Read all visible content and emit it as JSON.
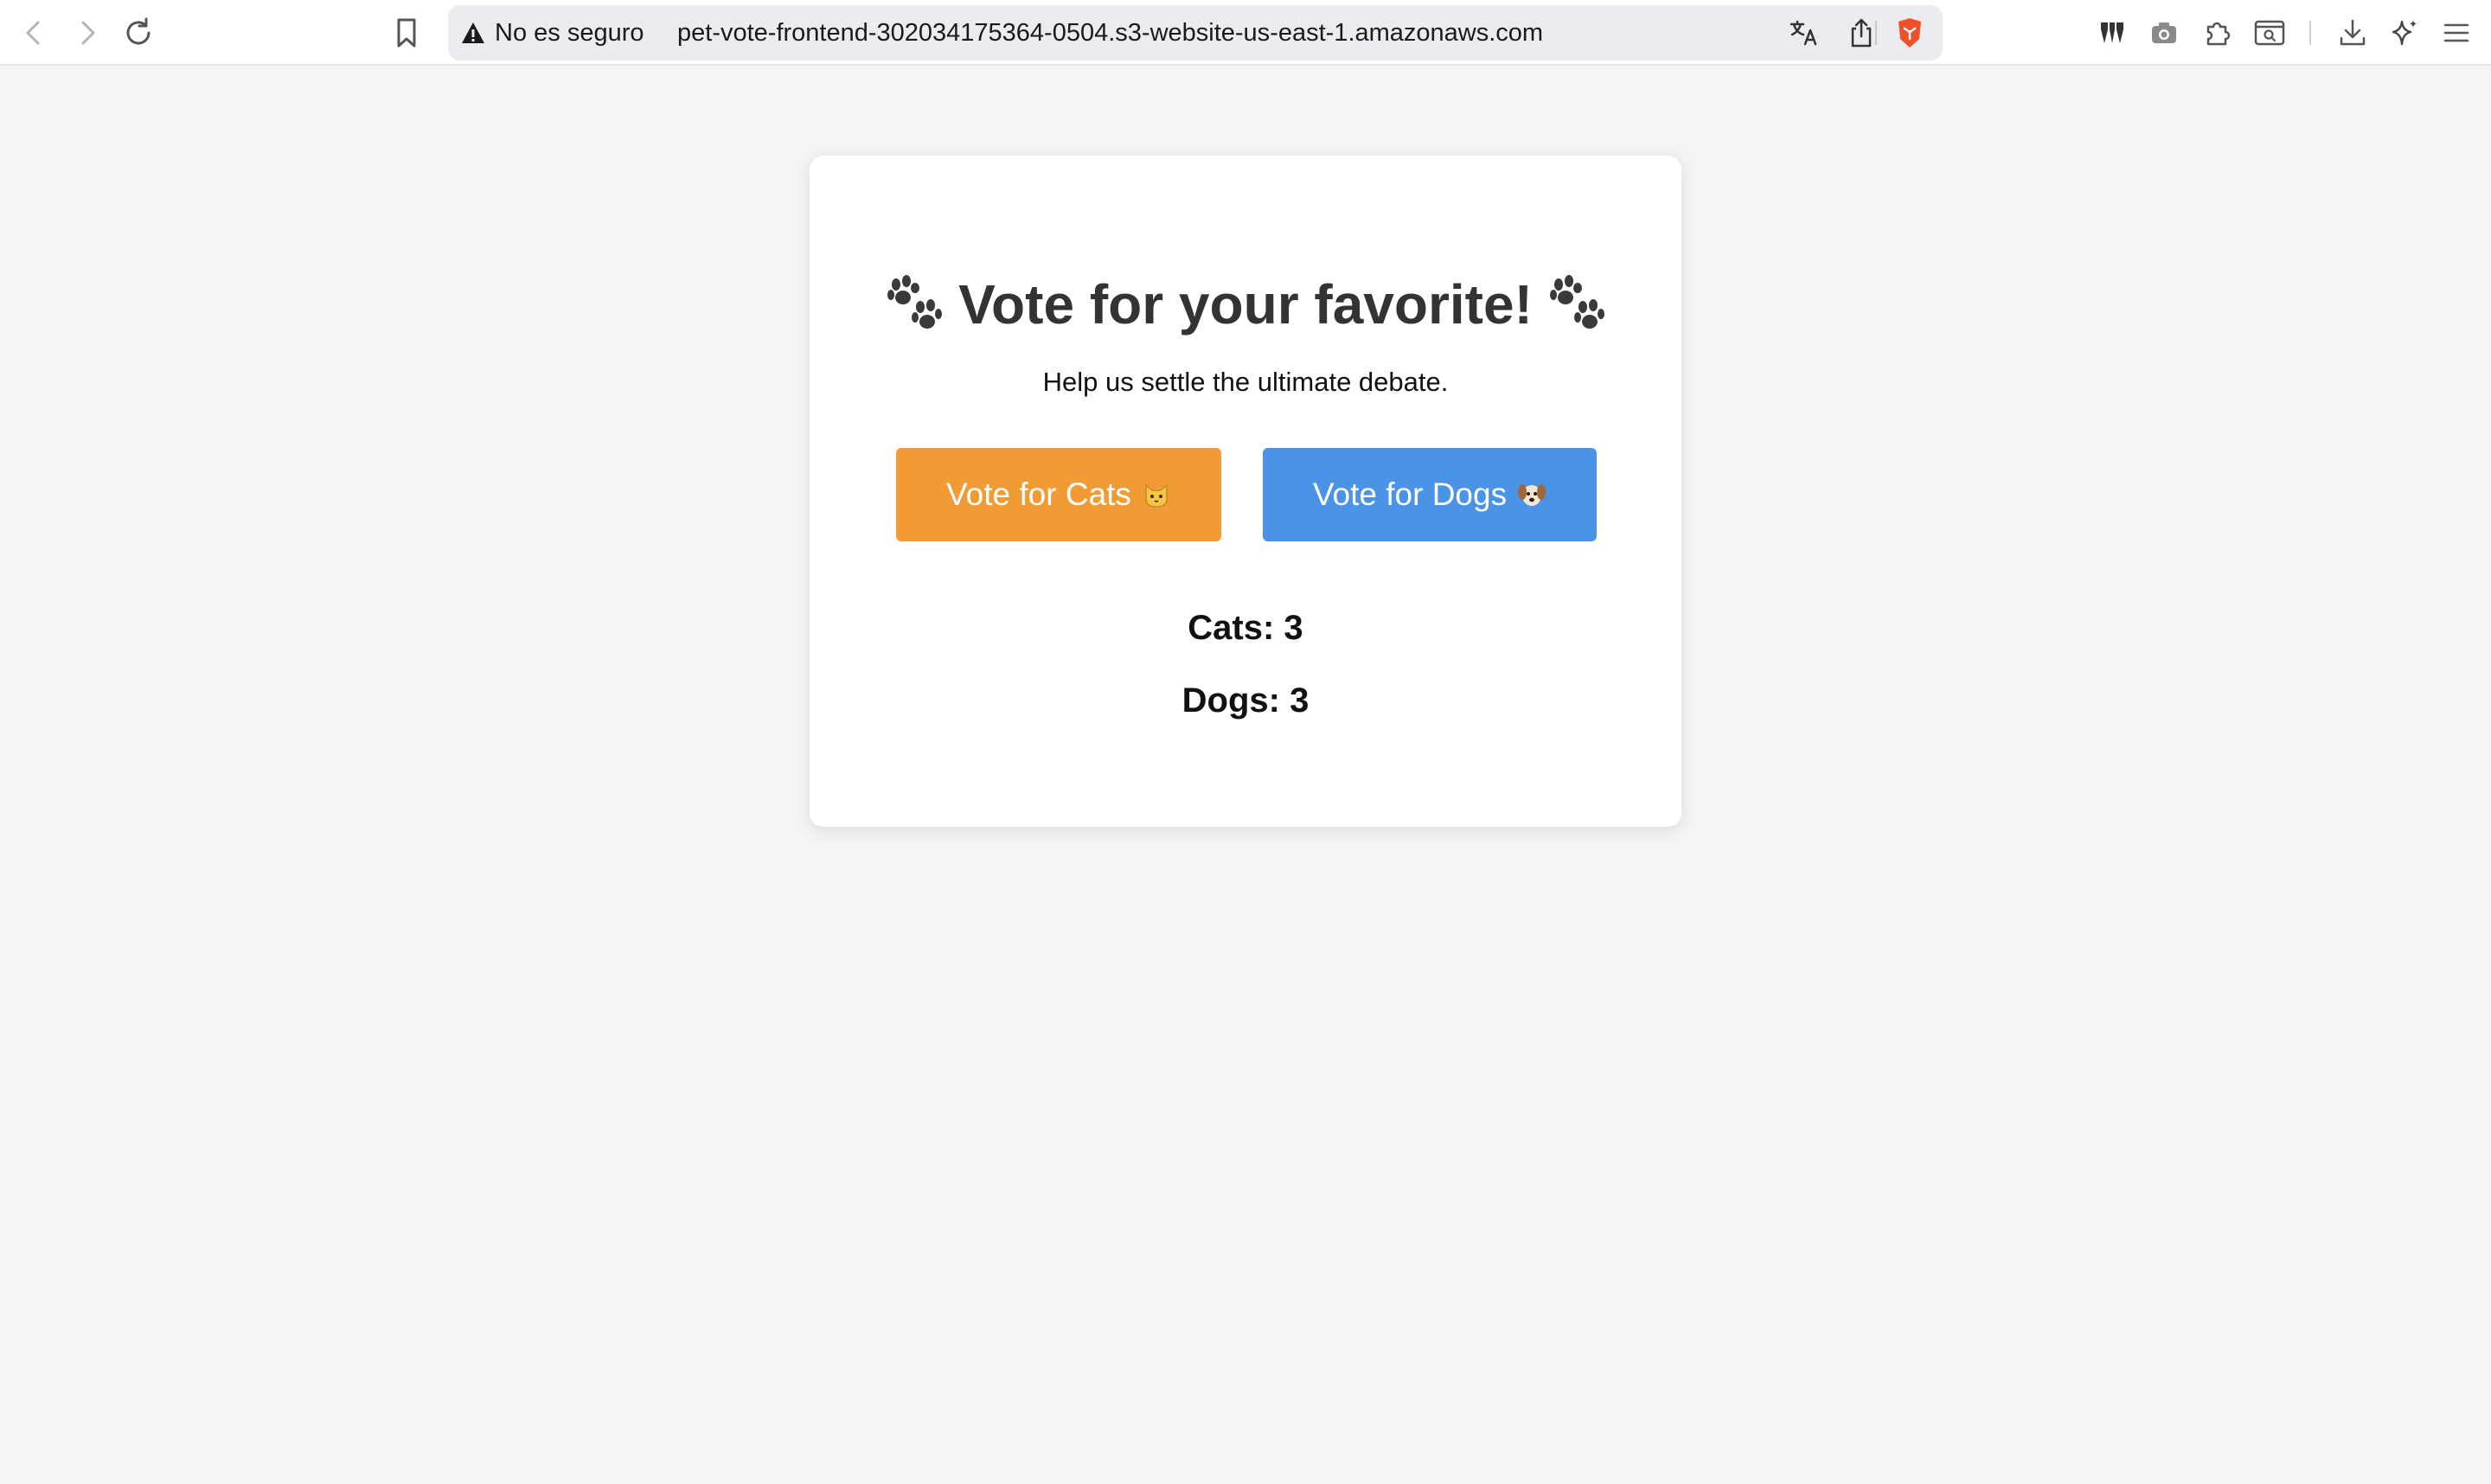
{
  "browser": {
    "security_label": "No es seguro",
    "url": "pet-vote-frontend-302034175364-0504.s3-website-us-east-1.amazonaws.com",
    "icons": [
      "back-icon",
      "forward-icon",
      "reload-icon",
      "bookmark-icon",
      "warning-icon",
      "translate-icon",
      "share-icon",
      "brave-shield-icon",
      "tools-icon",
      "camera-icon",
      "extensions-icon",
      "reader-icon",
      "download-icon",
      "leo-ai-icon",
      "menu-icon"
    ]
  },
  "card": {
    "title": "Vote for your favorite!",
    "subtitle": "Help us settle the ultimate debate.",
    "cats_button": "Vote for Cats",
    "dogs_button": "Vote for Dogs",
    "cats_count": "Cats: 3",
    "dogs_count": "Dogs: 3"
  },
  "colors": {
    "page_background": "#f3f5f4",
    "cats_button": "#f19b35",
    "dogs_button": "#4a93e7",
    "title_text": "#333333"
  }
}
